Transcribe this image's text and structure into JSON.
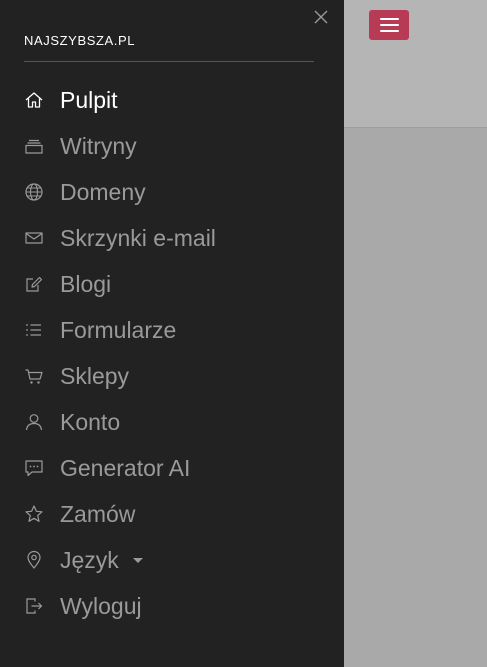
{
  "brand": {
    "title": "NAJSZYBSZA.PL"
  },
  "menu": [
    {
      "label": "Pulpit",
      "icon": "home-icon",
      "active": true
    },
    {
      "label": "Witryny",
      "icon": "layers-icon"
    },
    {
      "label": "Domeny",
      "icon": "globe-icon"
    },
    {
      "label": "Skrzynki e-mail",
      "icon": "envelope-icon"
    },
    {
      "label": "Blogi",
      "icon": "edit-icon"
    },
    {
      "label": "Formularze",
      "icon": "list-icon"
    },
    {
      "label": "Sklepy",
      "icon": "cart-icon"
    },
    {
      "label": "Konto",
      "icon": "user-icon"
    },
    {
      "label": "Generator AI",
      "icon": "chat-icon"
    },
    {
      "label": "Zamów",
      "icon": "star-icon"
    },
    {
      "label": "Język",
      "icon": "location-pin-icon",
      "dropdown": true
    },
    {
      "label": "Wyloguj",
      "icon": "logout-icon"
    }
  ],
  "colors": {
    "drawer_bg": "#222222",
    "accent": "#b83b56",
    "active_text": "#ffffff",
    "inactive_text": "#9a9a9a"
  }
}
